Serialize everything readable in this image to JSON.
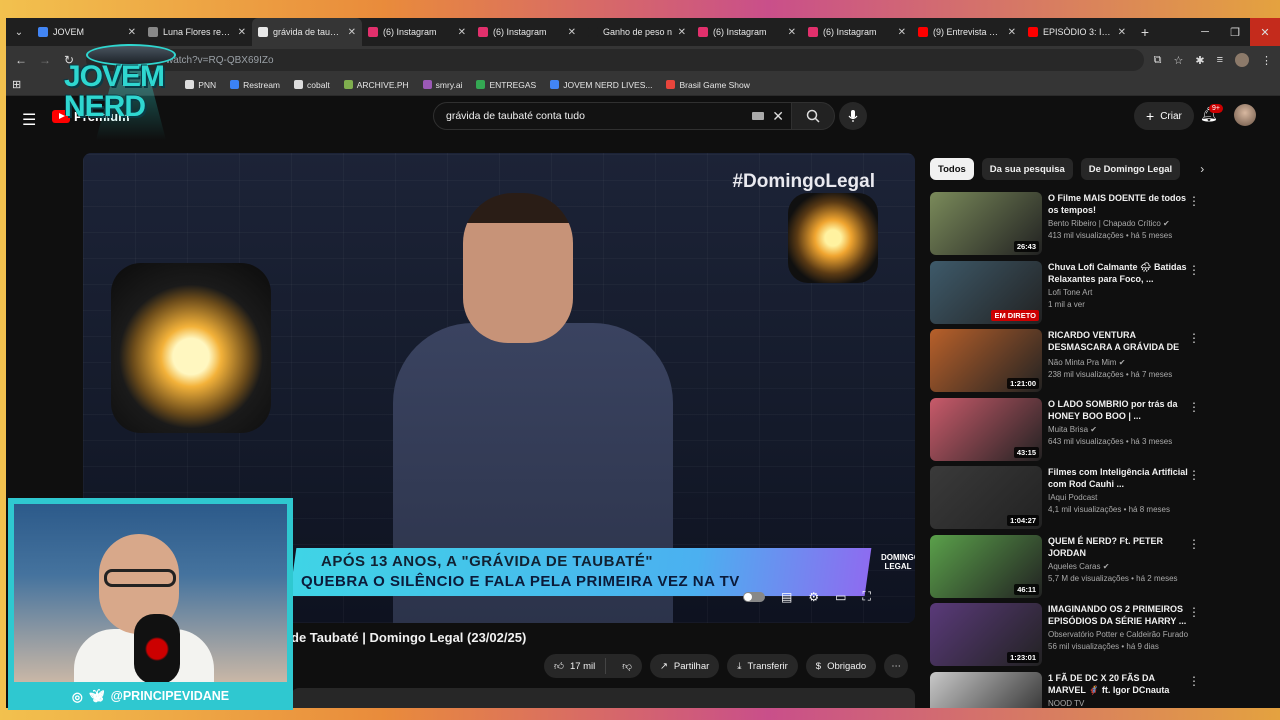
{
  "tabs": [
    {
      "title": "JOVEM",
      "color": "#4285f4",
      "active": false
    },
    {
      "title": "Luna Flores revela",
      "color": "#888888",
      "active": false
    },
    {
      "title": "grávida de taubaté",
      "color": "#e8e8e8",
      "active": true
    },
    {
      "title": "(6) Instagram",
      "color": "#e1306c",
      "active": false
    },
    {
      "title": "(6) Instagram",
      "color": "#e1306c",
      "active": false
    },
    {
      "title": "Ganho de peso n",
      "color": "#1f1f1f",
      "active": false
    },
    {
      "title": "(6) Instagram",
      "color": "#e1306c",
      "active": false
    },
    {
      "title": "(6) Instagram",
      "color": "#e1306c",
      "active": false
    },
    {
      "title": "(9) Entrevista excl",
      "color": "#ff0000",
      "active": false
    },
    {
      "title": "EPISÓDIO 3: Inici",
      "color": "#ff0000",
      "active": false
    }
  ],
  "omnibox": {
    "url": "watch?v=RQ-QBX69IZo"
  },
  "bookmarks": [
    {
      "label": "PNN",
      "color": "#dddddd"
    },
    {
      "label": "Restream",
      "color": "#3b82f6"
    },
    {
      "label": "cobalt",
      "color": "#dddddd"
    },
    {
      "label": "ARCHIVE.PH",
      "color": "#7fae4e"
    },
    {
      "label": "smry.ai",
      "color": "#9b59b6"
    },
    {
      "label": "ENTREGAS",
      "color": "#34a853"
    },
    {
      "label": "JOVEM NERD LIVES...",
      "color": "#4285f4"
    },
    {
      "label": "Brasil Game Show",
      "color": "#e8453c"
    }
  ],
  "youtube": {
    "logo_label": "Premium",
    "search_query": "grávida de taubaté conta tudo",
    "create_label": "Criar",
    "notif_count": "9+"
  },
  "video": {
    "hashtag": "#DomingoLegal",
    "lower_third_line1": "APÓS 13 ANOS, A \"GRÁVIDA DE TAUBATÉ\"",
    "lower_third_line2": "QUEBRA O SILÊNCIO E FALA PELA PRIMEIRA VEZ NA TV",
    "channel_bug": "DOMINGO LEGAL",
    "title": "de Taubaté | Domingo Legal (23/02/25)",
    "likes": "17 mil",
    "share_label": "Partilhar",
    "download_label": "Transferir",
    "thanks_label": "Obrigado"
  },
  "chips": [
    "Todos",
    "Da sua pesquisa",
    "De Domingo Legal"
  ],
  "recommendations": [
    {
      "title": "O Filme MAIS DOENTE de todos os tempos!",
      "channel": "Bento Ribeiro | Chapado Crítico",
      "verified": true,
      "stats": "413 mil visualizações • há 5 meses",
      "duration": "26:43",
      "live": false,
      "thumb": "#7a8a5a"
    },
    {
      "title": "Chuva Lofi Calmante 🌧 Batidas Relaxantes para Foco, ...",
      "channel": "Lofi Tone Art",
      "verified": false,
      "stats": "1 mil a ver",
      "duration": "EM DIRETO",
      "live": true,
      "thumb": "#3e5a6a"
    },
    {
      "title": "RICARDO VENTURA DESMASCARA A GRÁVIDA DE ...",
      "channel": "Não Minta Pra Mim",
      "verified": true,
      "stats": "238 mil visualizações • há 7 meses",
      "duration": "1:21:00",
      "live": false,
      "thumb": "#b8602a"
    },
    {
      "title": "O LADO SOMBRIO por trás da HONEY BOO BOO | ...",
      "channel": "Muita Brisa",
      "verified": true,
      "stats": "643 mil visualizações • há 3 meses",
      "duration": "43:15",
      "live": false,
      "thumb": "#c85a6a"
    },
    {
      "title": "Filmes com Inteligência Artificial com Rod Cauhi ...",
      "channel": "IAqui Podcast",
      "verified": false,
      "stats": "4,1 mil visualizações • há 8 meses",
      "duration": "1:04:27",
      "live": false,
      "thumb": "#3a3a3a"
    },
    {
      "title": "QUEM É NERD? Ft. PETER JORDAN",
      "channel": "Aqueles Caras",
      "verified": true,
      "stats": "5,7 M de visualizações • há 2 meses",
      "duration": "46:11",
      "live": false,
      "thumb": "#5aa04a"
    },
    {
      "title": "IMAGINANDO OS 2 PRIMEIROS EPISÓDIOS DA SÉRIE HARRY ...",
      "channel": "Observatório Potter e Caldeirão Furado",
      "verified": false,
      "stats": "56 mil visualizações • há 9 dias",
      "duration": "1:23:01",
      "live": false,
      "thumb": "#5a3a7a"
    },
    {
      "title": "1 FÃ DE DC X 20 FÃS DA MARVEL 🦸 ft. Igor DCnauta",
      "channel": "NOOD TV",
      "verified": false,
      "stats": "",
      "duration": "",
      "live": false,
      "thumb": "#c8c8c8"
    }
  ],
  "overlay": {
    "brand_line1": "JOVEM",
    "brand_line2": "NERD",
    "handle": "@PRINCIPEVIDANE"
  },
  "colors": {
    "accent": "#2fd7d0",
    "yt_red": "#ff0000"
  }
}
